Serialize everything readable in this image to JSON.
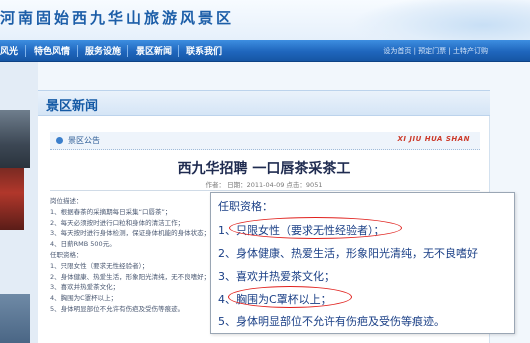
{
  "header": {
    "title": "河南固始西九华山旅游风景区"
  },
  "nav": {
    "items": [
      "风光",
      "特色风情",
      "服务设施",
      "景区新闻",
      "联系我们"
    ],
    "links": [
      "设为首页",
      "预定门票",
      "土特产订购"
    ],
    "link_separator": "|"
  },
  "main": {
    "section_title": "景区新闻",
    "announcement_label": "景区公告",
    "announcement_en": "XI JIU HUA SHAN",
    "article_title": "西九华招聘 一口唇茶采茶工",
    "article_meta": "作者：   日期：2011-04-09 点击：9051",
    "body_lines": [
      "岗位描述：",
      "1、根据春茶的采摘期每日采集“口唇茶”；",
      "2、每天必须按时进行口粒和身体的清洁工作；",
      "3、每天按时进行身体检测，保证身体机能的身体状态；",
      "4、日薪RMB 500元。",
      "任职资格：",
      "1、只限女性（要求无性经验者）；",
      "2、身体健康、热爱生活，形象阳光清纯，无不良嗜好；",
      "3、喜欢并热爱茶文化；",
      "4、胸围为C罩杯以上；",
      "5、身体明显部位不允许有伤疤及受伤等痕迹。"
    ]
  },
  "callout": {
    "title": "任职资格：",
    "lines": [
      "1、只限女性（要求无性经验者）；",
      "2、身体健康、热爱生活，形象阳光清纯，无不良嗜好",
      "3、喜欢并热爱茶文化；",
      "4、胸围为C罩杯以上；",
      "5、身体明显部位不允许有伤疤及受伤等痕迹。"
    ]
  },
  "colors": {
    "nav_blue": "#1f66bd",
    "title_blue": "#155aa5",
    "callout_text": "#1a3f86",
    "highlight_red": "#e0201c",
    "english_red": "#cc3a2a"
  }
}
